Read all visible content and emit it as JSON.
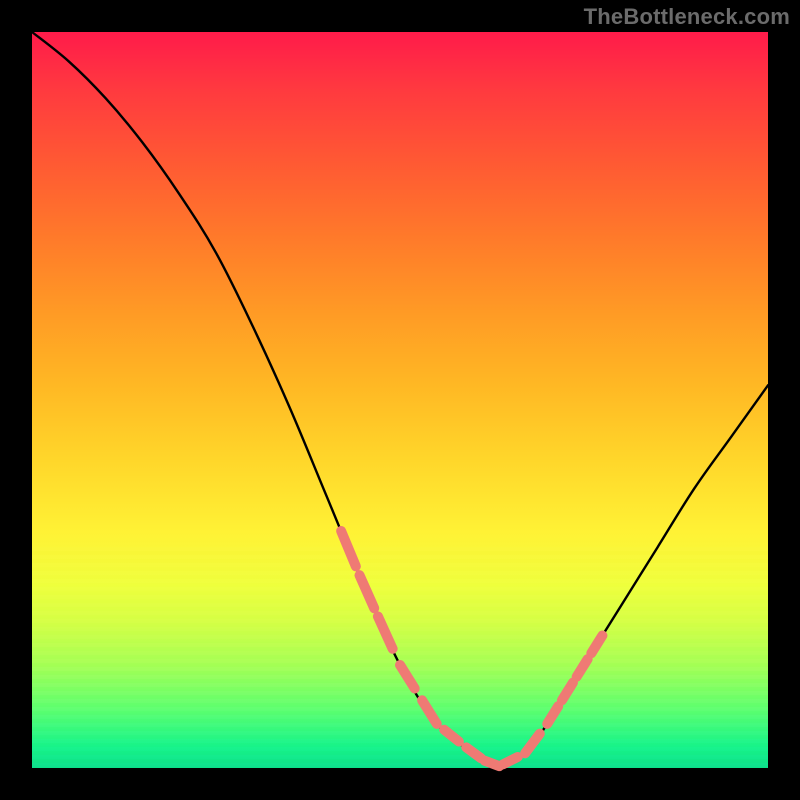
{
  "watermark": "TheBottleneck.com",
  "colors": {
    "background": "#000000",
    "curve": "#000000",
    "markers": "#ef7a74",
    "gradient_top": "#ff1b4a",
    "gradient_bottom": "#0de08a"
  },
  "chart_data": {
    "type": "line",
    "title": "",
    "xlabel": "",
    "ylabel": "",
    "xlim": [
      0,
      100
    ],
    "ylim": [
      0,
      100
    ],
    "grid": false,
    "legend": false,
    "annotations": [],
    "series": [
      {
        "name": "bottleneck-curve",
        "x": [
          0,
          5,
          10,
          15,
          20,
          25,
          30,
          35,
          40,
          45,
          50,
          55,
          60,
          63,
          67,
          70,
          75,
          80,
          85,
          90,
          95,
          100
        ],
        "y": [
          100,
          96,
          91,
          85,
          78,
          70,
          60,
          49,
          37,
          25,
          14,
          6,
          2,
          0,
          2,
          6,
          14,
          22,
          30,
          38,
          45,
          52
        ]
      }
    ],
    "markers": {
      "name": "highlighted-range-dashes",
      "style": "dash",
      "color": "#ef7a74",
      "segments_x": [
        [
          42,
          44
        ],
        [
          44.5,
          46.5
        ],
        [
          47,
          49
        ],
        [
          50,
          52
        ],
        [
          53,
          55
        ],
        [
          56,
          58
        ],
        [
          59,
          61
        ],
        [
          61.5,
          63.5
        ],
        [
          64,
          66
        ],
        [
          67,
          69
        ],
        [
          70,
          71.5
        ],
        [
          72,
          73.5
        ],
        [
          74,
          75.5
        ],
        [
          76,
          77.5
        ]
      ]
    }
  }
}
